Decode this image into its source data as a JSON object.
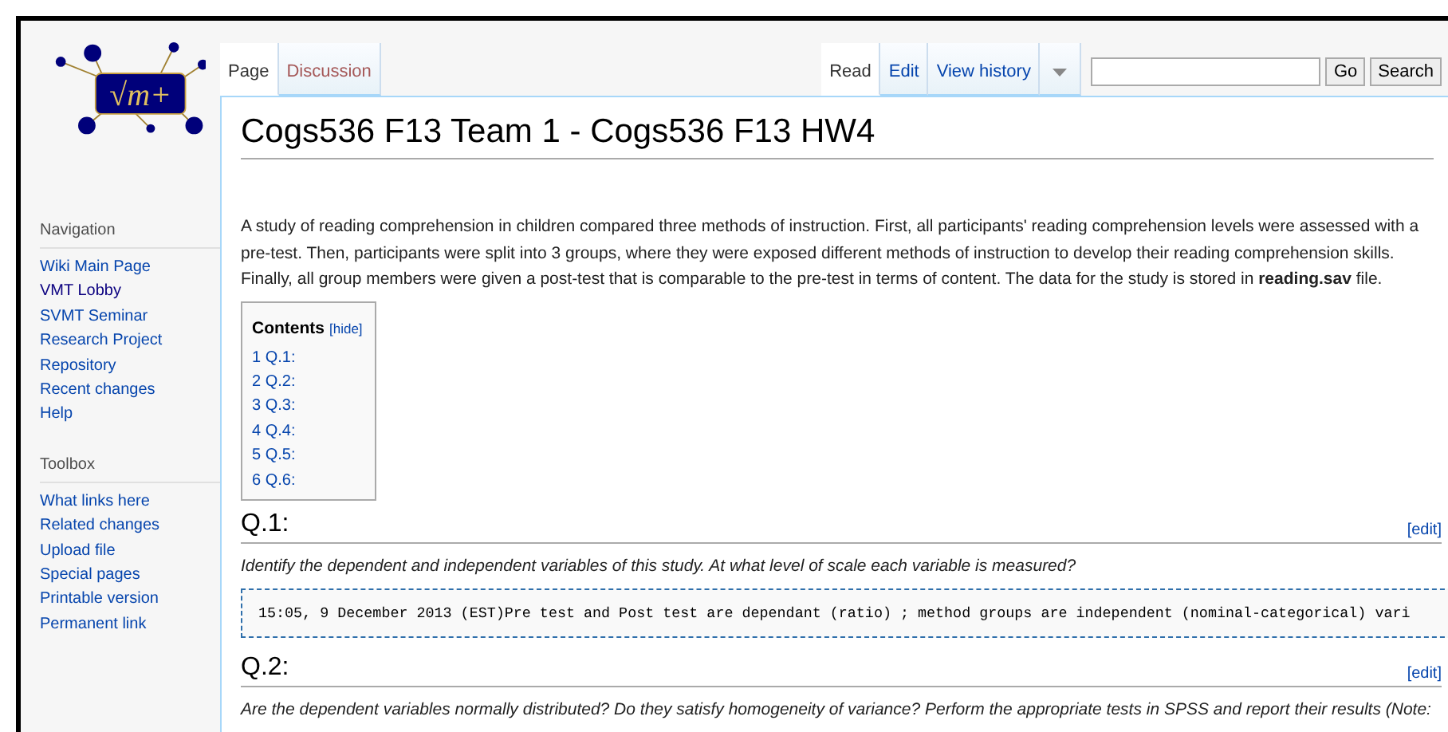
{
  "logo": {
    "text": "√m+"
  },
  "left_tabs": [
    {
      "label": "Page",
      "selected": true,
      "missing": false
    },
    {
      "label": "Discussion",
      "selected": false,
      "missing": true
    }
  ],
  "right_tabs": [
    {
      "label": "Read",
      "selected": true
    },
    {
      "label": "Edit",
      "selected": false
    },
    {
      "label": "View history",
      "selected": false
    }
  ],
  "search": {
    "go_button": "Go",
    "search_button": "Search"
  },
  "sidebar": [
    {
      "heading": "Navigation",
      "items": [
        {
          "label": "Wiki Main Page",
          "visited": false
        },
        {
          "label": "VMT Lobby",
          "visited": true
        },
        {
          "label": "SVMT Seminar",
          "visited": false
        },
        {
          "label": "Research Project",
          "visited": false
        },
        {
          "label": "Repository",
          "visited": false
        },
        {
          "label": "Recent changes",
          "visited": false
        },
        {
          "label": "Help",
          "visited": false
        }
      ]
    },
    {
      "heading": "Toolbox",
      "items": [
        {
          "label": "What links here",
          "visited": false
        },
        {
          "label": "Related changes",
          "visited": false
        },
        {
          "label": "Upload file",
          "visited": false
        },
        {
          "label": "Special pages",
          "visited": false
        },
        {
          "label": "Printable version",
          "visited": false
        },
        {
          "label": "Permanent link",
          "visited": false
        }
      ]
    }
  ],
  "title": "Cogs536 F13 Team 1 - Cogs536 F13 HW4",
  "intro": "A study of reading comprehension in children compared three methods of instruction. First, all participants' reading comprehension levels were assessed with a pre-test. Then, participants were split into 3 groups, where they were exposed different methods of instruction to develop their reading comprehension skills. Finally, all group members were given a post-test that is comparable to the pre-test in terms of content. The data for the study is stored in **reading.sav** file.",
  "toc": {
    "title": "Contents",
    "hide_link": "[hide]",
    "items": [
      {
        "number": "1",
        "text": "Q.1:"
      },
      {
        "number": "2",
        "text": "Q.2:"
      },
      {
        "number": "3",
        "text": "Q.3:"
      },
      {
        "number": "4",
        "text": "Q.4:"
      },
      {
        "number": "5",
        "text": "Q.5:"
      },
      {
        "number": "6",
        "text": "Q.6:"
      }
    ]
  },
  "sections": [
    {
      "heading": "Q.1:",
      "edit_link": "[edit]",
      "question": "Identify the dependent and independent variables of this study. At what level of scale each variable is measured?",
      "answer": "15:05, 9 December 2013 (EST)Pre test and Post test are dependant (ratio) ; method groups are independent (nominal-categorical) vari"
    },
    {
      "heading": "Q.2:",
      "edit_link": "[edit]",
      "question": "Are the dependent variables normally distributed? Do they satisfy homogeneity of variance? Perform the appropriate tests in SPSS and report their results (Note:"
    }
  ]
}
